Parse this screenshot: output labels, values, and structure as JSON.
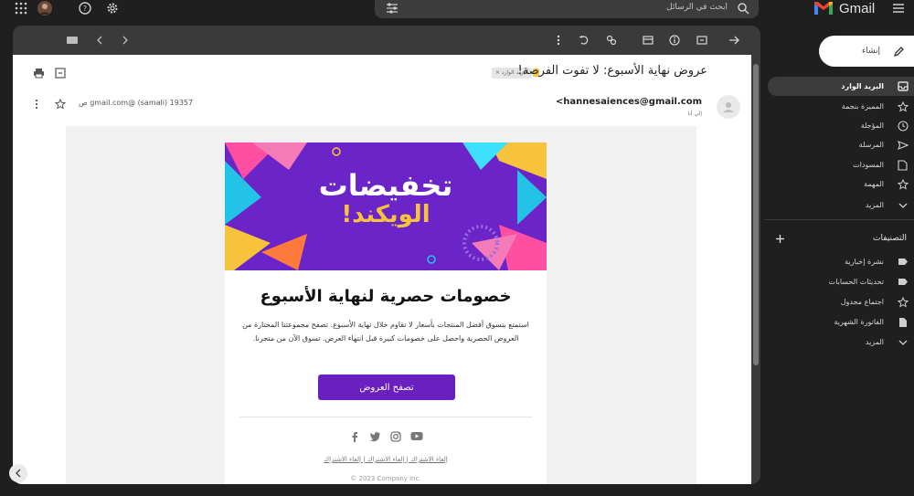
{
  "app": {
    "name": "Gmail"
  },
  "search": {
    "placeholder": "ابحث في الرسائل"
  },
  "sidebar": {
    "compose_label": "إنشاء",
    "items": [
      {
        "label": "البريد الوارد",
        "icon": "inbox-icon",
        "active": true
      },
      {
        "label": "المميزة بنجمة",
        "icon": "star-icon"
      },
      {
        "label": "المؤجلة",
        "icon": "clock-icon"
      },
      {
        "label": "المرسلة",
        "icon": "send-icon"
      },
      {
        "label": "المسودات",
        "icon": "draft-icon"
      },
      {
        "label": "المهمة",
        "icon": "important-icon"
      },
      {
        "label": "المزيد",
        "icon": "chevron-down-icon"
      }
    ],
    "labels_title": "التصنيفات",
    "labels": [
      {
        "label": "نشرة إخبارية",
        "icon": "label-icon"
      },
      {
        "label": "تحديثات الحسابات",
        "icon": "label-icon"
      },
      {
        "label": "اجتماع مجدول",
        "icon": "star-icon"
      },
      {
        "label": "الفاتورة الشهرية",
        "icon": "doc-icon"
      },
      {
        "label": "المزيد",
        "icon": "chevron-down-icon"
      }
    ]
  },
  "email": {
    "subject": "عروض نهاية الأسبوع: لا تفوت الفرصة!",
    "chip": "البريد الوارد ×",
    "sender": "<hannesaiences@gmail.com",
    "to": "إلي أنا",
    "meta": "19357 (samali) @gmail.com ص"
  },
  "newsletter": {
    "banner_line1": "تخفيضات",
    "banner_line2": "الويكند!",
    "heading": "خصومات حصرية لنهاية الأسبوع",
    "paragraph": "استمتع بتسوق أفضل المنتجات بأسعار لا تقاوم خلال نهاية الأسبوع. تصفح مجموعتنا المختارة من العروض الحصرية واحصل على خصومات كبيرة قبل انتهاء العرض. تسوق الآن من متجرنا.",
    "cta_label": "تصفح العروض",
    "footer_links": "إلغاء الاشتراك | إلغاء الاشتراك | إلغاء الاشتراك",
    "copyright": "© 2023 Company Inc."
  },
  "colors": {
    "accent": "#6a1fc1",
    "banner_bg": "#6b24c7",
    "gold": "#f8c33c"
  }
}
